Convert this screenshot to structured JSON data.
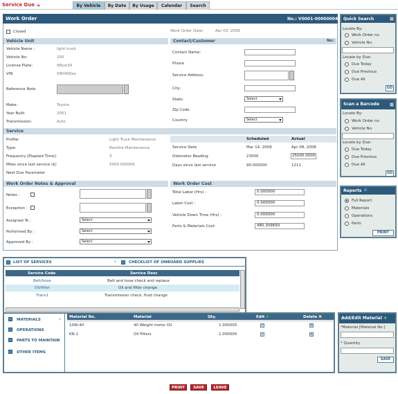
{
  "app": {
    "title": "Service Due"
  },
  "tabs": [
    {
      "label": "By Vehicle"
    },
    {
      "label": "By Date"
    },
    {
      "label": "By Usage"
    },
    {
      "label": "Calendar"
    },
    {
      "label": "Search"
    }
  ],
  "workorder": {
    "title": "Work Order",
    "no_label": "No.:",
    "no_value": "V0001-00000004",
    "closed_label": "Closed",
    "date_label": "Work Order Date:",
    "date_value": "Apr 03, 2008"
  },
  "vehicle_unit": {
    "section": "Vehicle Unit",
    "rows": [
      {
        "label": "Vehicle Name :",
        "value": "light truck"
      },
      {
        "label": "Vehicle No:",
        "value": "200"
      },
      {
        "label": "License Plate:",
        "value": "98yst34"
      },
      {
        "label": "VIN",
        "value": "58tf400se"
      }
    ],
    "reference_label": "Reference Note",
    "rows2": [
      {
        "label": "Make:",
        "value": "Toyota"
      },
      {
        "label": "Year Built:",
        "value": "2001"
      },
      {
        "label": "Transmission:",
        "value": "Auto"
      }
    ]
  },
  "contact": {
    "section": "Contact/Customer",
    "no": "No:",
    "fields": [
      "Contact Name:",
      "Phone",
      "Service Address:",
      "City:",
      "State:",
      "Zip Code",
      "Country"
    ],
    "state_value": "Select",
    "country_value": "Select"
  },
  "service": {
    "section": "Service",
    "rows": [
      {
        "label": "Profile:",
        "value": "Light Truck Maintenance"
      },
      {
        "label": "Type:",
        "value": "Routine Maintenance"
      },
      {
        "label": "Frequency [Elapsed Time]:",
        "value": "3"
      },
      {
        "label": "Miles since last service ($)",
        "value": "5000.000000"
      },
      {
        "label": "Next Due Parameter",
        "value": ""
      }
    ],
    "table_headers": [
      "",
      "Scheduled",
      "Actual"
    ],
    "table_rows": [
      {
        "label": "Service Date",
        "scheduled": "Mar 14, 2009",
        "actual": "Apr 08, 2008"
      },
      {
        "label": "Odometer Reading",
        "scheduled": "23000",
        "actual": "25000.0000"
      },
      {
        "label": "Days since last service",
        "scheduled": "90.000000",
        "actual": "1211"
      }
    ]
  },
  "notes": {
    "section": "Work Order Notes & Approval",
    "notes_label": "Notes :",
    "exception_label": "Exception :",
    "assigned_label": "Assigned To :",
    "performed_label": "Performed By :",
    "approved_label": "Approved By :",
    "select": "Select"
  },
  "cost": {
    "section": "Work Order Cost",
    "rows": [
      {
        "label": "Total Labor (Hrs) :",
        "value": "0.000000"
      },
      {
        "label": "Labor Cost :",
        "value": "0.000000"
      },
      {
        "label": "Vehicle Down Time (Hrs) :",
        "value": "0.000000"
      },
      {
        "label": "Parts & Materials Cost:",
        "value": "480.309650"
      }
    ]
  },
  "quick_search": {
    "title": "Quick Search",
    "locate_label": "Locate By:",
    "options": [
      "Work Order no",
      "Vehicle No."
    ],
    "due_label": "Locate by Due:",
    "due_options": [
      "Due Today",
      "Due Previous",
      "Due All"
    ],
    "go": "GO"
  },
  "barcode": {
    "title": "Scan a Barcode",
    "locate_label": "Locate By:",
    "options": [
      "Work Order no",
      "Vehicle No."
    ],
    "due_label": "Locate by Due:",
    "due_options": [
      "Due Today",
      "Due Previous",
      "Due All"
    ],
    "go": "GO"
  },
  "reports": {
    "title": "Reports",
    "options": [
      "Full Report",
      "Materials",
      "Operations",
      "Parts"
    ],
    "print": "PRINT"
  },
  "services": {
    "list_title": "LIST OF SERVICES",
    "checklist_title": "CHECKLIST OF ONBOARD SUPPLIES",
    "headers": [
      "Service Code",
      "Service Desc"
    ],
    "rows": [
      {
        "code": "Belt/hose",
        "desc": "Belt and hose check and replace"
      },
      {
        "code": "Oil/filter",
        "desc": "Oil and filter change"
      },
      {
        "code": "Trans1",
        "desc": "Transmission check, fluid change"
      }
    ]
  },
  "materials": {
    "nav": [
      "MATERIALS",
      "OPERATIONS",
      "PARTS TO MAINTAIN",
      "OTHER ITEMS"
    ],
    "headers": [
      "Material No.",
      "Material",
      "Qty.",
      "Edit",
      "Delete"
    ],
    "rows": [
      {
        "no": "10W-40",
        "name": "40 Weight motor Oil",
        "qty": "1.000000"
      },
      {
        "no": "KN 1",
        "name": "Oil Filters",
        "qty": "1.000000"
      }
    ]
  },
  "add_material": {
    "title": "Add/Edit Material",
    "material_label": "Material [Material No.]",
    "qty_label": "Quantity",
    "save": "SAVE"
  },
  "footer": {
    "print": "PRINT",
    "save": "SAVE",
    "leave": "LEAVE"
  }
}
